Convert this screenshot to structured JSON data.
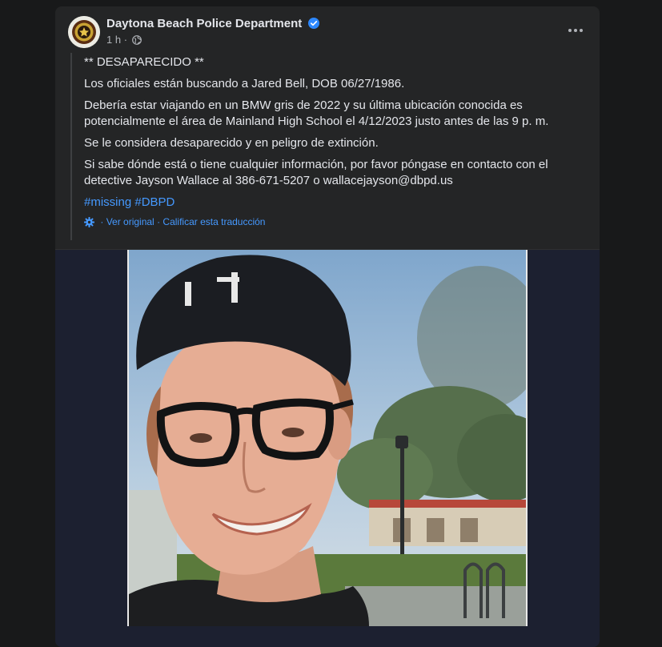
{
  "post": {
    "page_name": "Daytona Beach Police Department",
    "timestamp": "1 h",
    "dot": "·",
    "paragraphs": [
      "** DESAPARECIDO **",
      "Los oficiales están buscando a Jared Bell, DOB 06/27/1986.",
      "Debería estar viajando en un BMW gris de 2022 y su última ubicación conocida es potencialmente el área de Mainland High School el 4/12/2023 justo antes de las 9 p. m.",
      "Se le considera desaparecido y en peligro de extinción.",
      "Si sabe dónde está o tiene cualquier información, por favor póngase en contacto con el detective Jayson Wallace al 386-671-5207 o wallacejayson@dbpd.us"
    ],
    "hashtags": [
      "#missing",
      "#DBPD"
    ],
    "translation": {
      "view_original": "Ver original",
      "separator": "·",
      "rate": "Calificar esta traducción"
    }
  },
  "icons": {
    "verified": "verified-badge-icon",
    "audience": "globe-icon",
    "more": "more-options-icon",
    "translation": "gear-icon"
  },
  "colors": {
    "background": "#18191a",
    "card": "#242526",
    "text": "#e4e6eb",
    "secondary_text": "#b0b3b8",
    "link": "#4599ff",
    "verified": "#2d88ff"
  }
}
